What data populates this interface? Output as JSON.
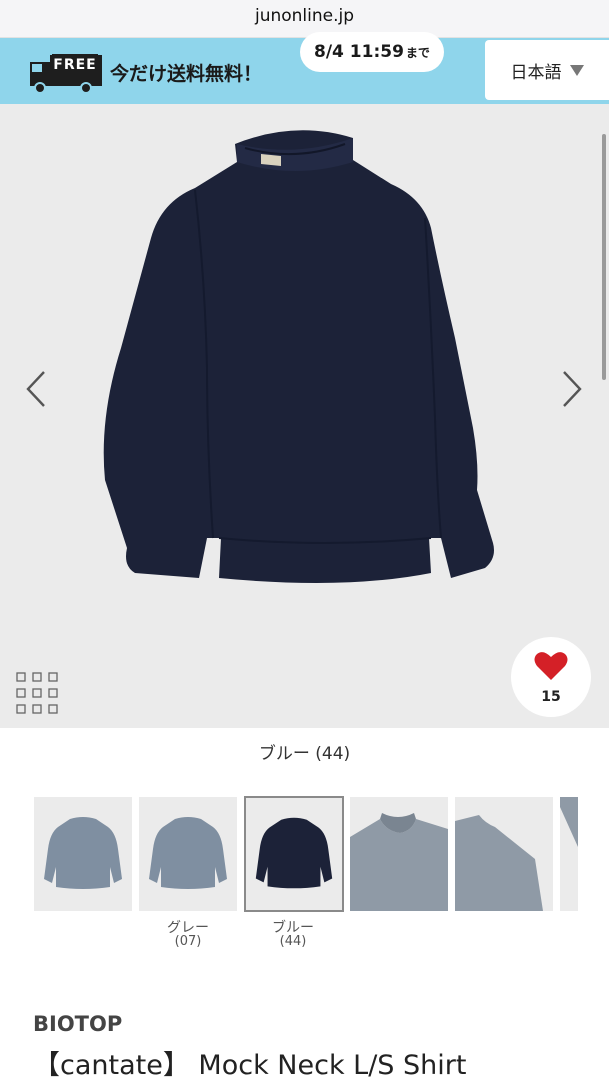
{
  "browser": {
    "url": "junonline.jp"
  },
  "promo_banner": {
    "free_badge": "FREE",
    "message": "今だけ送料無料！",
    "deadline_time": "8/4 11:59",
    "deadline_suffix": "まで",
    "background": "#8fd5eb"
  },
  "language_selector": {
    "label": "日本語",
    "icon": "caret-down-icon"
  },
  "gallery": {
    "icons": [
      "chevron-left-icon",
      "chevron-right-icon",
      "grid-view-icon",
      "heart-icon"
    ],
    "favorite_count": "15",
    "heart_color": "#d42027",
    "product_color": "#1c2238"
  },
  "selected_color_label": "ブルー (44)",
  "color_thumbnails": [
    {
      "name": "",
      "code": "",
      "color": "#7f8fa1",
      "selected": false
    },
    {
      "name": "グレー",
      "code": "(07)",
      "color": "#7f8fa1",
      "selected": false
    },
    {
      "name": "ブルー",
      "code": "(44)",
      "color": "#1c2238",
      "selected": true
    },
    {
      "name": "",
      "code": "",
      "color": "#8f9aa6",
      "selected": false
    },
    {
      "name": "",
      "code": "",
      "color": "#8f9aa6",
      "selected": false
    }
  ],
  "product": {
    "brand": "BIOTOP",
    "title": "【cantate】 Mock Neck L/S Shirt"
  }
}
